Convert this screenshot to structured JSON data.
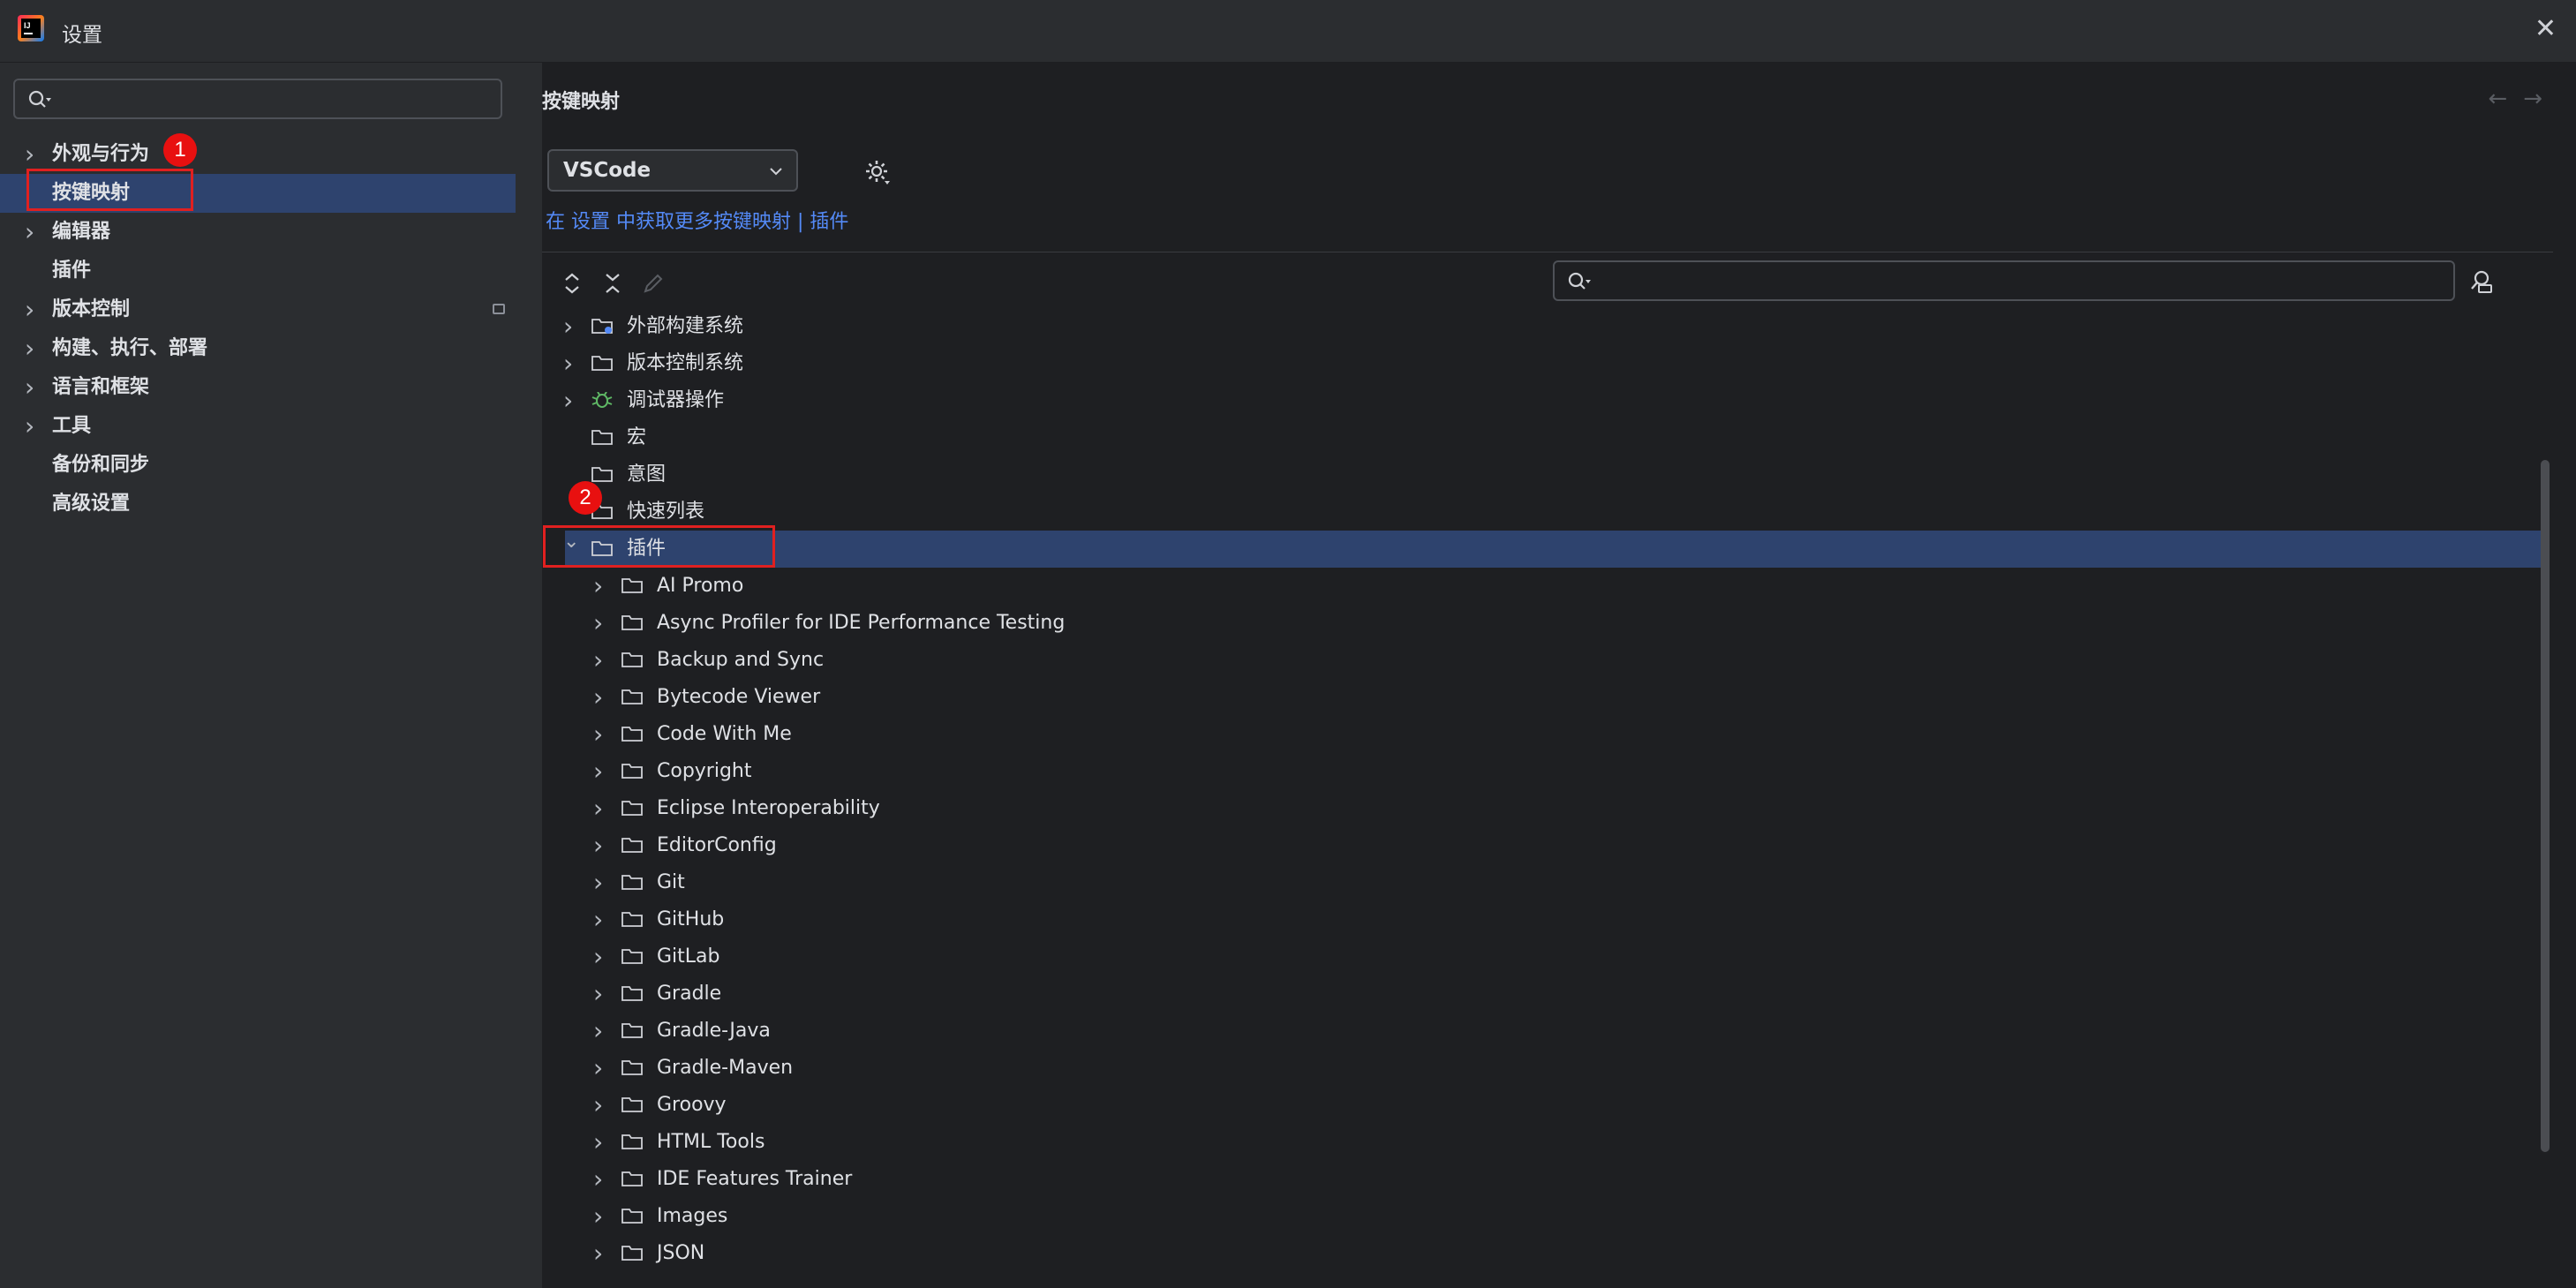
{
  "window": {
    "title": "设置",
    "close_glyph": "✕"
  },
  "sidebar": {
    "search_placeholder": "",
    "items": [
      {
        "label": "外观与行为",
        "expandable": true
      },
      {
        "label": "按键映射",
        "expandable": false,
        "selected": true
      },
      {
        "label": "编辑器",
        "expandable": true
      },
      {
        "label": "插件",
        "expandable": false
      },
      {
        "label": "版本控制",
        "expandable": true,
        "has_side_icon": true
      },
      {
        "label": "构建、执行、部署",
        "expandable": true
      },
      {
        "label": "语言和框架",
        "expandable": true
      },
      {
        "label": "工具",
        "expandable": true
      },
      {
        "label": "备份和同步",
        "expandable": false
      },
      {
        "label": "高级设置",
        "expandable": false
      }
    ]
  },
  "main": {
    "title": "按键映射",
    "back_glyph": "←",
    "forward_glyph": "→",
    "keymap_value": "VSCode",
    "more_link": "在 设置 中获取更多按键映射 | 插件",
    "tree_search_placeholder": ""
  },
  "tree": {
    "top_items": [
      {
        "label": "外部构建系统",
        "icon": "external-build-folder-icon",
        "expandable": true
      },
      {
        "label": "版本控制系统",
        "icon": "folder-icon",
        "expandable": true
      },
      {
        "label": "调试器操作",
        "icon": "bug-icon",
        "expandable": true
      },
      {
        "label": "宏",
        "icon": "folder-icon",
        "expandable": false
      },
      {
        "label": "意图",
        "icon": "folder-icon",
        "expandable": false
      },
      {
        "label": "快速列表",
        "icon": "folder-icon",
        "expandable": false
      },
      {
        "label": "插件",
        "icon": "folder-icon",
        "expandable": true,
        "expanded": true,
        "selected": true
      }
    ],
    "plugin_children": [
      "AI Promo",
      "Async Profiler for IDE Performance Testing",
      "Backup and Sync",
      "Bytecode Viewer",
      "Code With Me",
      "Copyright",
      "Eclipse Interoperability",
      "EditorConfig",
      "Git",
      "GitHub",
      "GitLab",
      "Gradle",
      "Gradle-Java",
      "Gradle-Maven",
      "Groovy",
      "HTML Tools",
      "IDE Features Trainer",
      "Images",
      "JSON"
    ]
  },
  "annotations": {
    "badge_1": "1",
    "badge_2": "2"
  },
  "colors": {
    "background": "#2b2d30",
    "panel": "#1e1f22",
    "selection": "#2e436e",
    "link": "#548af7",
    "annotation": "#e02020"
  }
}
